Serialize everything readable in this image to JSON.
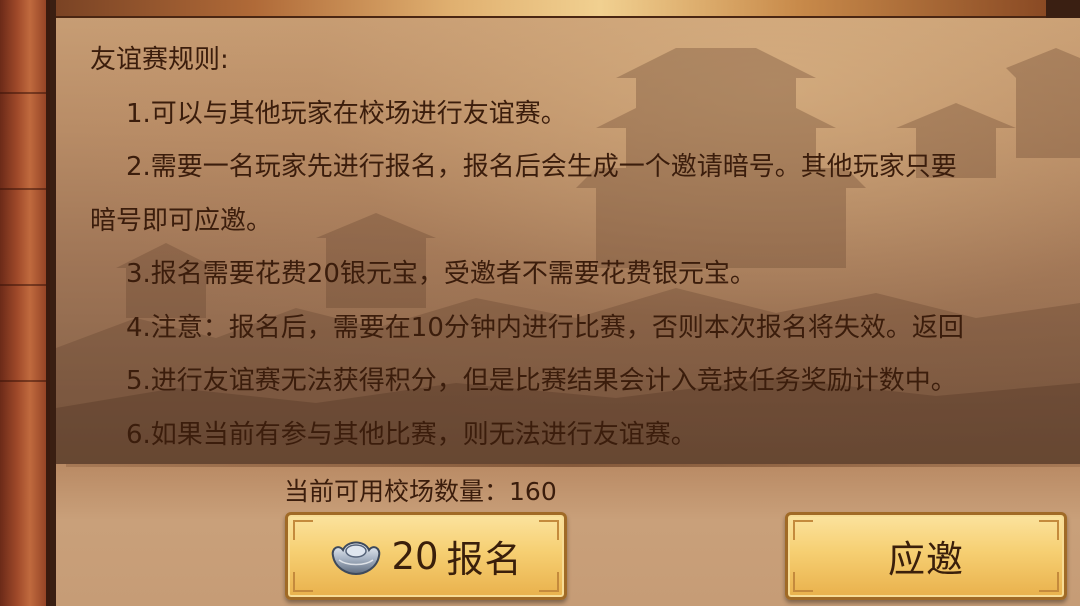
{
  "rules": {
    "title": "友谊赛规则:",
    "items": [
      "1.可以与其他玩家在校场进行友谊赛。",
      "2.需要一名玩家先进行报名，报名后会生成一个邀请暗号。其他玩家只要",
      "暗号即可应邀。",
      "3.报名需要花费20银元宝，受邀者不需要花费银元宝。",
      "4.注意：报名后，需要在10分钟内进行比赛，否则本次报名将失效。返回",
      "5.进行友谊赛无法获得积分，但是比赛结果会计入竞技任务奖励计数中。",
      "6.如果当前有参与其他比赛，则无法进行友谊赛。"
    ]
  },
  "venue": {
    "label": "当前可用校场数量：",
    "count": "160"
  },
  "register_button": {
    "cost": "20",
    "label": "报名",
    "icon": "silver-ingot-icon"
  },
  "accept_button": {
    "label": "应邀"
  },
  "colors": {
    "text": "#3b1d0c",
    "button_gold": "#f6cf72",
    "button_border": "#a06a26"
  }
}
